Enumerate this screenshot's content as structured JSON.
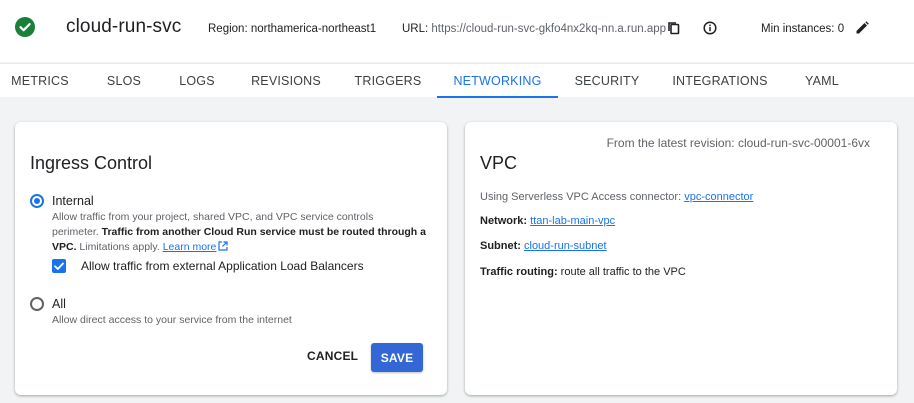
{
  "header": {
    "service_name": "cloud-run-svc",
    "region": "Region: northamerica-northeast1",
    "url_label": "URL:",
    "url_value": "https://cloud-run-svc-gkfo4nx2kq-nn.a.run.app",
    "min_instances": "Min instances: 0",
    "status_color": "#188038"
  },
  "tabs": [
    {
      "label": "METRICS"
    },
    {
      "label": "SLOS"
    },
    {
      "label": "LOGS"
    },
    {
      "label": "REVISIONS"
    },
    {
      "label": "TRIGGERS"
    },
    {
      "label": "NETWORKING",
      "active": true
    },
    {
      "label": "SECURITY"
    },
    {
      "label": "INTEGRATIONS"
    },
    {
      "label": "YAML"
    }
  ],
  "ingress": {
    "title": "Ingress Control",
    "option_internal": {
      "label": "Internal",
      "checked": true,
      "desc_1": "Allow traffic from your project, shared VPC, and VPC service controls",
      "desc_2_plain": "perimeter. ",
      "desc_2_bold": "Traffic from another Cloud Run service must be routed through a",
      "desc_3_bold": "VPC.",
      "desc_3_plain": " Limitations apply. ",
      "learn_more": "Learn more"
    },
    "checkbox_alb": {
      "label": "Allow traffic from external Application Load Balancers",
      "checked": true
    },
    "option_all": {
      "label": "All",
      "checked": false,
      "desc": "Allow direct access to your service from the internet"
    },
    "cancel_label": "CANCEL",
    "save_label": "SAVE"
  },
  "vpc": {
    "revision_note": "From the latest revision: cloud-run-svc-00001-6vx",
    "title": "VPC",
    "connector_label": "Using Serverless VPC Access connector: ",
    "connector_value": "vpc-connector",
    "network_label": "Network: ",
    "network_value": "ttan-lab-main-vpc",
    "subnet_label": "Subnet: ",
    "subnet_value": "cloud-run-subnet",
    "routing_label": "Traffic routing: ",
    "routing_value": "route all traffic to the VPC"
  },
  "colors": {
    "accent": "#1a73e8",
    "save_button": "#3367d6"
  },
  "icons": {
    "status": "check-circle-icon",
    "copy": "copy-icon",
    "info": "info-icon",
    "edit": "pencil-icon",
    "external": "open-in-new-icon"
  }
}
